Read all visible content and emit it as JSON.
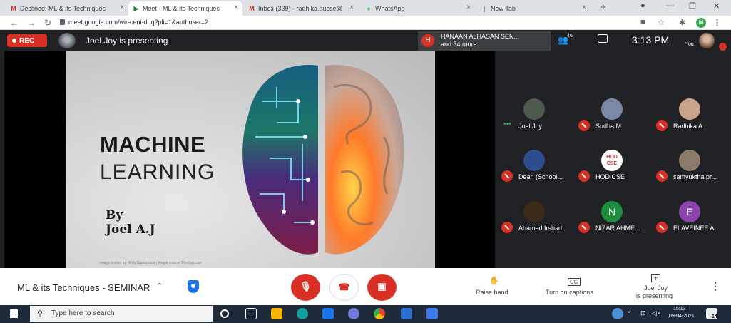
{
  "browser": {
    "tabs": [
      {
        "favicon": "gmail-icon",
        "title": "Declined: ML & its Techniques",
        "close": "×"
      },
      {
        "favicon": "meet-icon",
        "title": "Meet - ML & its Techniques",
        "close": "×"
      },
      {
        "favicon": "gmail-icon",
        "title": "Inbox (339) - radhika.bucse@",
        "close": "×"
      },
      {
        "favicon": "whatsapp-icon",
        "title": "WhatsApp",
        "close": "×"
      },
      {
        "favicon": "new-tab-icon",
        "title": "New Tab",
        "close": "×"
      }
    ],
    "new_tab": "+",
    "url": "meet.google.com/wir-ceni-duq?pli=1&authuser=2",
    "profile_initial": "M"
  },
  "meet": {
    "rec_label": "REC",
    "presenting_title": "Joel Joy is presenting",
    "raised_hand_avatar": "H",
    "raised_hand_name": "HANAAN ALHASAN SEN...",
    "raised_hand_more": "and 34 more",
    "participant_count": "46",
    "time": "3:13 PM",
    "you_label": "You"
  },
  "slide": {
    "title_line1": "MACHINE",
    "title_line2": "LEARNING",
    "by": "By",
    "author": "Joel A.J",
    "credit": "Image hosted by: WittySparks.com | Image source: Pixabay.com"
  },
  "participants": [
    {
      "name": "Joel Joy",
      "initial": "",
      "color": "#4f5a4f",
      "speaking": true
    },
    {
      "name": "Sudha M",
      "initial": "",
      "color": "#7a8aa6",
      "speaking": false
    },
    {
      "name": "Radhika A",
      "initial": "",
      "color": "#c9a38a",
      "speaking": false
    },
    {
      "name": "Dean (School...",
      "initial": "",
      "color": "#2e4d8f",
      "speaking": false
    },
    {
      "name": "HOD CSE",
      "initial": "HOD CSE",
      "color": "#ffffff",
      "speaking": false
    },
    {
      "name": "samyuktha pr...",
      "initial": "",
      "color": "#8c7a6a",
      "speaking": false
    },
    {
      "name": "Ahamed Irshad",
      "initial": "",
      "color": "#3a2a1a",
      "speaking": false
    },
    {
      "name": "NIZAR AHME...",
      "initial": "N",
      "color": "#1e8e3e",
      "speaking": false
    },
    {
      "name": "ELAVEINEE A",
      "initial": "E",
      "color": "#8e44ad",
      "speaking": false
    }
  ],
  "bottom": {
    "meeting_title": "ML & its Techniques - SEMINAR",
    "raise_hand": "Raise hand",
    "captions": "Turn on captions",
    "presenting_line1": "Joel Joy",
    "presenting_line2": "is presenting"
  },
  "taskbar": {
    "search_placeholder": "Type here to search",
    "clock_time": "15:13",
    "clock_date": "09-04-2021",
    "notification_count": "14"
  }
}
